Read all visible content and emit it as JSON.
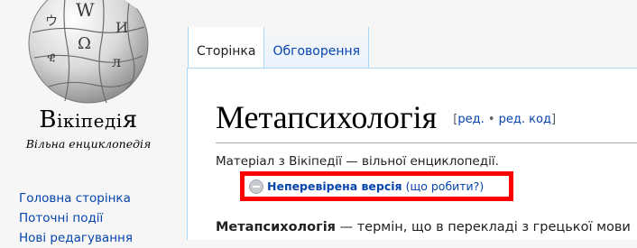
{
  "logo": {
    "wordmark_first": "В",
    "wordmark_rest": "ікіпеді",
    "wordmark_last": "я",
    "wordmark_tail": "",
    "tagline": "Вільна енциклопедія"
  },
  "sidebar": {
    "items": [
      {
        "label": "Головна сторінка"
      },
      {
        "label": "Поточні події"
      },
      {
        "label": "Нові редагування"
      }
    ]
  },
  "tabs": [
    {
      "label": "Сторінка",
      "selected": true
    },
    {
      "label": "Обговорення",
      "selected": false
    }
  ],
  "page": {
    "title": "Метапсихологія",
    "edit_open": "[",
    "edit_label": "ред.",
    "edit_sep": " • ",
    "edit_code_label": "ред. код",
    "edit_close": "]",
    "site_sub": "Матеріал з Вікіпедії — вільної енциклопедії.",
    "flag_status": "Неперевірена версія",
    "flag_help_open": "(",
    "flag_help": "що робити?",
    "flag_help_close": ")",
    "lede_bold": "Метапсихологія",
    "lede_rest": " — термін, що в перекладі з грецької мови"
  },
  "colors": {
    "link": "#0645ad",
    "highlight_box": "#ff0000",
    "tab_border": "#a7d7f9"
  },
  "icons": {
    "logo": "wikipedia-puzzle-globe",
    "flag": "unreviewed-minus-circle-icon"
  }
}
